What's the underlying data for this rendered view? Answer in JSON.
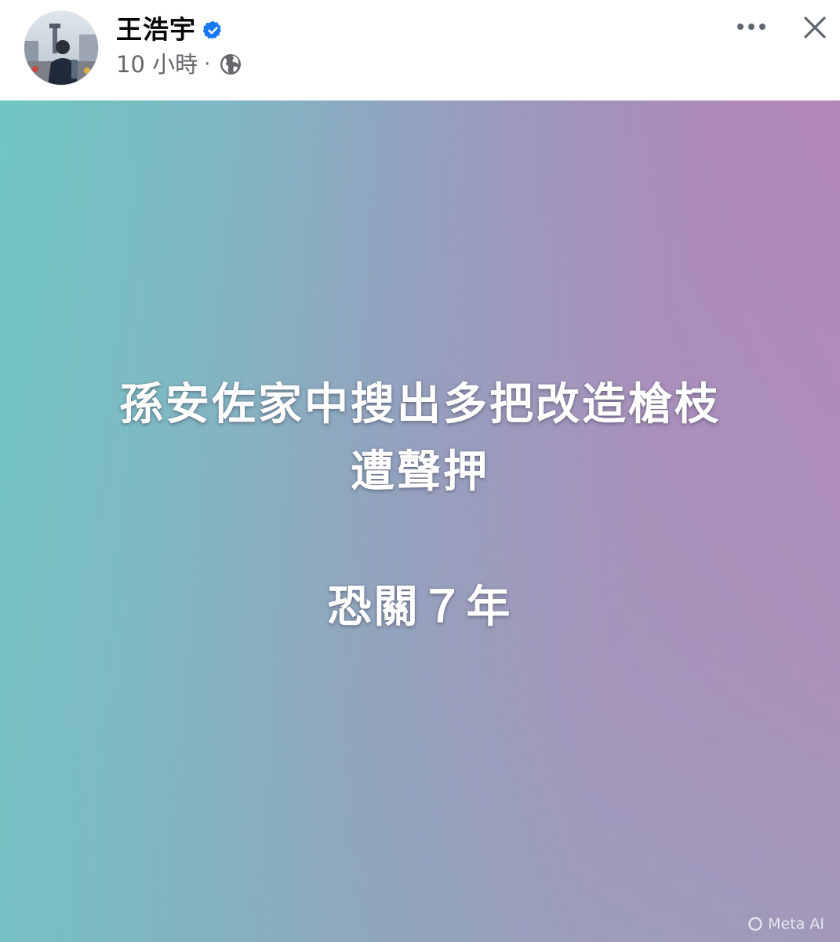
{
  "post": {
    "author": {
      "name": "王浩宇",
      "verified": true,
      "avatar_icon": "profile-photo-icon"
    },
    "time": "10 小時",
    "separator": "·",
    "audience_icon": "globe-icon",
    "actions": {
      "more_icon": "more-horizontal-icon",
      "close_icon": "close-icon"
    },
    "background": {
      "colors": [
        "#6fc6c0",
        "#989cbd",
        "#b784b8"
      ]
    },
    "text_lines": [
      "孫安佐家中搜出多把改造槍枝",
      "遭聲押",
      "恐關７年"
    ],
    "badge": "Meta AI"
  },
  "colors": {
    "verified_blue": "#1877f2",
    "meta_text": "#65676b",
    "name_text": "#050505"
  }
}
